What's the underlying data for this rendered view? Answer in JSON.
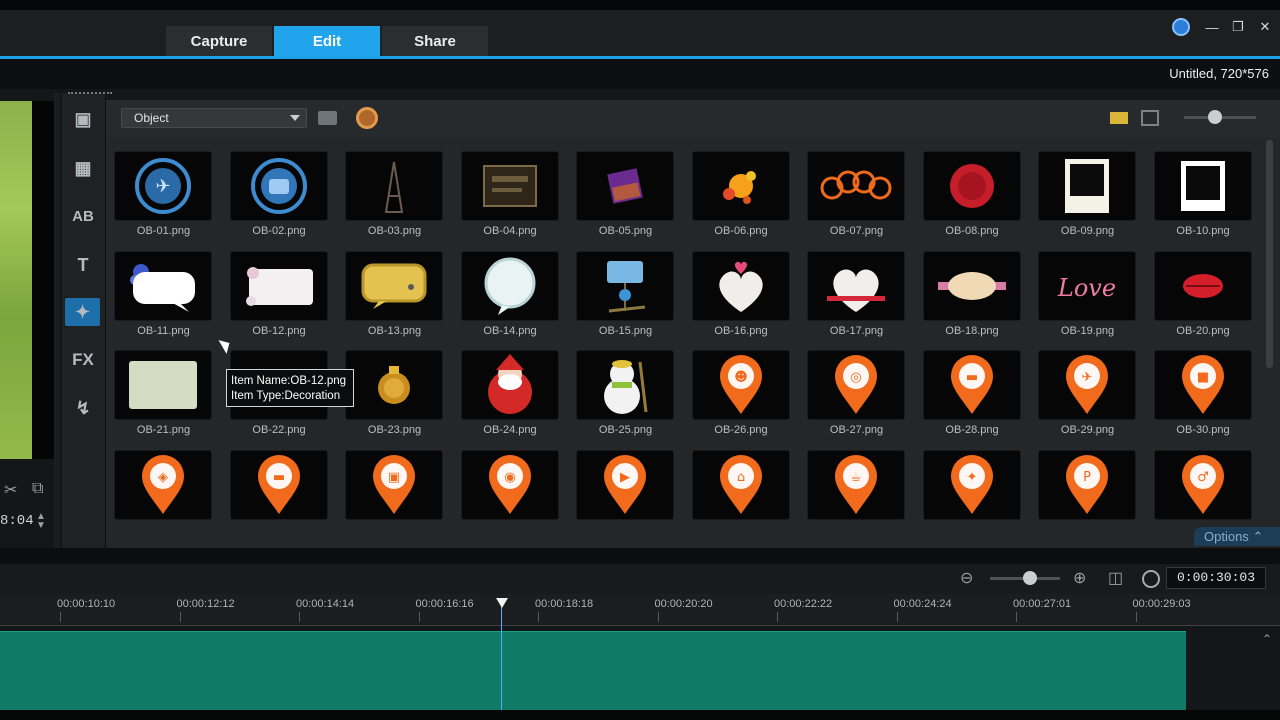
{
  "header": {
    "tabs": [
      {
        "label": "Capture",
        "active": false
      },
      {
        "label": "Edit",
        "active": true
      },
      {
        "label": "Share",
        "active": false
      }
    ],
    "window_controls": [
      "minimize",
      "maximize",
      "close"
    ],
    "accent_color": "#1ea0e6"
  },
  "project": {
    "title": "Untitled, 720*576"
  },
  "left_panel": {
    "timecode_fragment": "8:04"
  },
  "library": {
    "category": "Object",
    "sidebar_icons": [
      "media-icon",
      "instant-project-icon",
      "transition-icon",
      "title-icon",
      "graphic-icon",
      "filter-icon",
      "path-icon"
    ],
    "items": [
      {
        "name": "OB-01.png",
        "art": "passport-stamp"
      },
      {
        "name": "OB-02.png",
        "art": "suitcase-stamp"
      },
      {
        "name": "OB-03.png",
        "art": "eiffel-tower"
      },
      {
        "name": "OB-04.png",
        "art": "ticket-stamp"
      },
      {
        "name": "OB-05.png",
        "art": "purple-square"
      },
      {
        "name": "OB-06.png",
        "art": "paint-splash"
      },
      {
        "name": "OB-07.png",
        "art": "orange-circles"
      },
      {
        "name": "OB-08.png",
        "art": "red-wax-seal"
      },
      {
        "name": "OB-09.png",
        "art": "polaroid-frame"
      },
      {
        "name": "OB-10.png",
        "art": "white-frame"
      },
      {
        "name": "OB-11.png",
        "art": "speech-bubble"
      },
      {
        "name": "OB-12.png",
        "art": "floral-card"
      },
      {
        "name": "OB-13.png",
        "art": "yellow-bubble"
      },
      {
        "name": "OB-14.png",
        "art": "round-bubble"
      },
      {
        "name": "OB-15.png",
        "art": "bird-sign"
      },
      {
        "name": "OB-16.png",
        "art": "hearts"
      },
      {
        "name": "OB-17.png",
        "art": "heart-ribbon"
      },
      {
        "name": "OB-18.png",
        "art": "label-banner"
      },
      {
        "name": "OB-19.png",
        "art": "love-text"
      },
      {
        "name": "OB-20.png",
        "art": "lips"
      },
      {
        "name": "OB-21.png",
        "art": "green-card"
      },
      {
        "name": "OB-22.png",
        "art": "hidden"
      },
      {
        "name": "OB-23.png",
        "art": "ornament"
      },
      {
        "name": "OB-24.png",
        "art": "santa"
      },
      {
        "name": "OB-25.png",
        "art": "snowman"
      },
      {
        "name": "OB-26.png",
        "art": "pin-thumb"
      },
      {
        "name": "OB-27.png",
        "art": "pin-bike"
      },
      {
        "name": "OB-28.png",
        "art": "pin-car"
      },
      {
        "name": "OB-29.png",
        "art": "pin-plane"
      },
      {
        "name": "OB-30.png",
        "art": "pin-train"
      },
      {
        "name": "",
        "art": "pin-food"
      },
      {
        "name": "",
        "art": "pin-car"
      },
      {
        "name": "",
        "art": "pin-bag"
      },
      {
        "name": "",
        "art": "pin-camera"
      },
      {
        "name": "",
        "art": "pin-video"
      },
      {
        "name": "",
        "art": "pin-home"
      },
      {
        "name": "",
        "art": "pin-cup"
      },
      {
        "name": "",
        "art": "pin-gift"
      },
      {
        "name": "",
        "art": "pin-parking"
      },
      {
        "name": "",
        "art": "pin-restroom"
      }
    ],
    "tooltip": {
      "line1": "Item Name:OB-12.png",
      "line2": "Item Type:Decoration"
    },
    "options_label": "Options"
  },
  "timeline": {
    "ruler": [
      "00:00:10:10",
      "00:00:12:12",
      "00:00:14:14",
      "00:00:16:16",
      "00:00:18:18",
      "00:00:20:20",
      "00:00:22:22",
      "00:00:24:24",
      "00:00:27:01",
      "00:00:29:03"
    ],
    "duration": "0:00:30:03",
    "clip_color": "#0f7a66",
    "zoom_level": 0.57
  }
}
